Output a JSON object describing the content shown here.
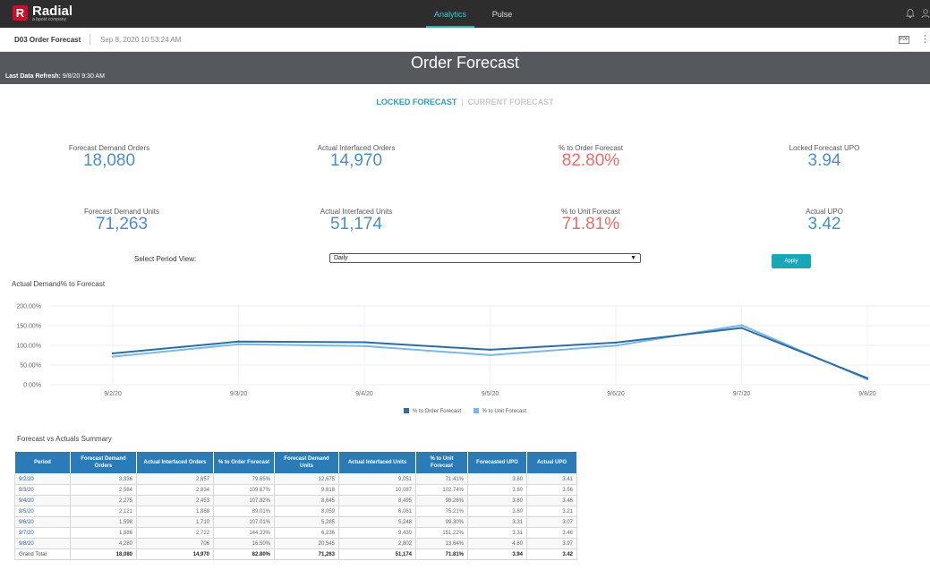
{
  "topbar": {
    "logo_text": "Radial",
    "logo_sub": "a bpost company",
    "tabs": [
      {
        "label": "Analytics"
      },
      {
        "label": "Pulse"
      }
    ]
  },
  "subheader": {
    "dashboard_name": "D03 Order Forecast",
    "timestamp": "Sep 8, 2020 10:53:24 AM",
    "pdf_label": "PDF"
  },
  "banner": {
    "title": "Order Forecast",
    "refresh_label": "Last Data Refresh:",
    "refresh_value": "9/8/20 9:30 AM"
  },
  "toggle": {
    "locked": "LOCKED FORECAST",
    "current": "CURRENT FORECAST"
  },
  "kpis": [
    {
      "label": "Forecast Demand Orders",
      "value": "18,080"
    },
    {
      "label": "Actual Interfaced Orders",
      "value": "14,970"
    },
    {
      "label": "% to Order Forecast",
      "value": "82.80%"
    },
    {
      "label": "Locked Forecast UPO",
      "value": "3.94"
    },
    {
      "label": "Forecast Demand Units",
      "value": "71,263"
    },
    {
      "label": "Actual Interfaced Units",
      "value": "51,174"
    },
    {
      "label": "% to Unit Forecast",
      "value": "71.81%"
    },
    {
      "label": "Actual UPO",
      "value": "3.42"
    }
  ],
  "period": {
    "label": "Select Period View:",
    "selected": "Daily",
    "apply_label": "Apply"
  },
  "colors": {
    "series_order": "#2e6da4",
    "series_unit": "#7ab8e6",
    "kpi_blue": "#4a8fc8",
    "kpi_red": "#ef6b6b",
    "accent": "#17a7b6"
  },
  "chart_data": {
    "type": "line",
    "title": "Actual Demand% to Forecast",
    "x": [
      "9/2/20",
      "9/3/20",
      "9/4/20",
      "9/5/20",
      "9/6/20",
      "9/7/20",
      "9/8/20"
    ],
    "y_ticks": [
      "200.00%",
      "150.00%",
      "100.00%",
      "50.00%",
      "0.00%"
    ],
    "ylim": [
      0,
      200
    ],
    "series": [
      {
        "name": "% to Order Forecast",
        "values": [
          79.65,
          109.67,
          107.82,
          89.01,
          107.01,
          144.33,
          16.5
        ]
      },
      {
        "name": "% to Unit Forecast",
        "values": [
          71.41,
          102.74,
          98.26,
          75.21,
          99.3,
          151.22,
          13.64
        ]
      }
    ],
    "legend": "bottom-center"
  },
  "table": {
    "title": "Forecast vs Actuals Summary",
    "headers": [
      "Period",
      "Forecast Demand Orders",
      "Actual Interfaced Orders",
      "% to Order Forecast",
      "Forecast Demand Units",
      "Actual Interfaced Units",
      "% to Unit Forecast",
      "Forecasted UPO",
      "Actual UPO"
    ],
    "rows": [
      [
        "9/2/20",
        "3,336",
        "2,657",
        "79.65%",
        "12,675",
        "9,051",
        "71.41%",
        "3.80",
        "3.41"
      ],
      [
        "9/3/20",
        "2,584",
        "2,834",
        "109.67%",
        "9,818",
        "10,087",
        "102.74%",
        "3.80",
        "3.56"
      ],
      [
        "9/4/20",
        "2,275",
        "2,453",
        "107.82%",
        "8,645",
        "8,495",
        "98.26%",
        "3.80",
        "3.46"
      ],
      [
        "9/5/20",
        "2,121",
        "1,888",
        "89.01%",
        "8,059",
        "6,061",
        "75.21%",
        "3.80",
        "3.21"
      ],
      [
        "9/6/20",
        "1,598",
        "1,710",
        "107.01%",
        "5,285",
        "5,248",
        "99.30%",
        "3.31",
        "3.07"
      ],
      [
        "9/7/20",
        "1,886",
        "2,722",
        "144.33%",
        "6,236",
        "9,430",
        "151.22%",
        "3.31",
        "3.46"
      ],
      [
        "9/8/20",
        "4,280",
        "706",
        "16.50%",
        "20,545",
        "2,802",
        "13.64%",
        "4.80",
        "3.97"
      ]
    ],
    "total": [
      "Grand Total",
      "18,080",
      "14,970",
      "82.80%",
      "71,263",
      "51,174",
      "71.81%",
      "3.94",
      "3.42"
    ]
  }
}
